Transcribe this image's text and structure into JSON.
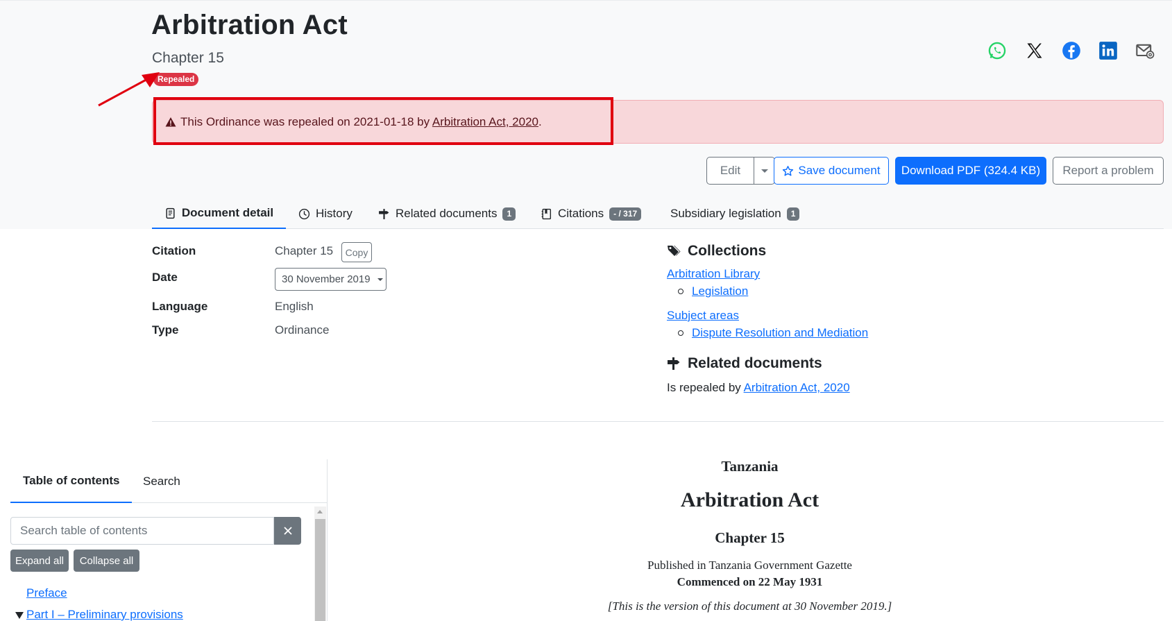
{
  "header": {
    "title": "Arbitration Act",
    "subtitle": "Chapter 15",
    "status_badge": "Repealed"
  },
  "share_icons": [
    "whatsapp-icon",
    "x-icon",
    "facebook-icon",
    "linkedin-icon",
    "email-icon"
  ],
  "alert": {
    "text_before": "This Ordinance was repealed on 2021-01-18 by ",
    "link": "Arbitration Act, 2020",
    "text_after": "."
  },
  "actions": {
    "edit": "Edit",
    "save": "Save document",
    "download": "Download PDF (324.4 KB)",
    "report": "Report a problem"
  },
  "tabs": [
    {
      "label": "Document detail",
      "active": true,
      "icon": "document-icon"
    },
    {
      "label": "History",
      "icon": "clock-icon"
    },
    {
      "label": "Related documents",
      "count": "1",
      "icon": "signpost-icon"
    },
    {
      "label": "Citations",
      "count": "- / 317",
      "icon": "journal-icon"
    },
    {
      "label": "Subsidiary legislation",
      "count": "1"
    }
  ],
  "details": {
    "citation_label": "Citation",
    "citation_value": "Chapter 15",
    "copy_label": "Copy",
    "date_label": "Date",
    "date_value": "30 November 2019",
    "language_label": "Language",
    "language_value": "English",
    "type_label": "Type",
    "type_value": "Ordinance"
  },
  "collections": {
    "heading": "Collections",
    "library": "Arbitration Library",
    "library_child": "Legislation",
    "subject_areas": "Subject areas",
    "subject_child": "Dispute Resolution and Mediation"
  },
  "related": {
    "heading": "Related documents",
    "text": "Is repealed by ",
    "link": "Arbitration Act, 2020"
  },
  "toc": {
    "tab_contents": "Table of contents",
    "tab_search": "Search",
    "search_placeholder": "Search table of contents",
    "expand_all": "Expand all",
    "collapse_all": "Collapse all",
    "items": [
      "Preface",
      "Part I – Preliminary provisions"
    ]
  },
  "document": {
    "country": "Tanzania",
    "title": "Arbitration Act",
    "chapter": "Chapter 15",
    "published": "Published in Tanzania Government Gazette",
    "commenced": "Commenced on 22 May 1931",
    "version_note": "[This is the version of this document at 30 November 2019.]"
  },
  "colors": {
    "primary": "#0d6efd",
    "danger": "#dc3545",
    "alert_bg": "#f8d7da",
    "highlight": "#e0000f",
    "secondary": "#6c757d"
  }
}
